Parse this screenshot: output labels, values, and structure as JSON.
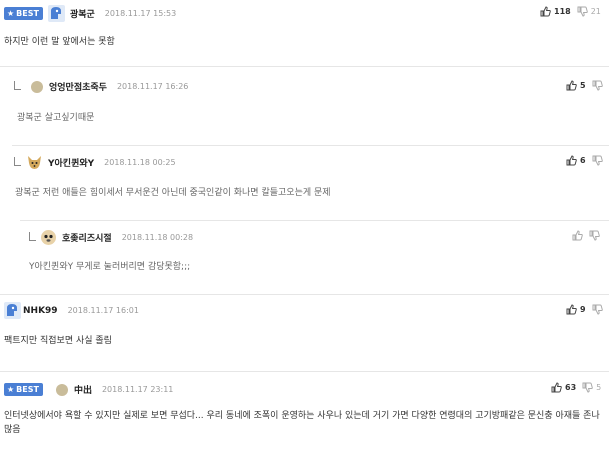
{
  "badge_label": "BEST",
  "comments": [
    {
      "nick": "광복군",
      "date": "2018.11.17 15:53",
      "text": "하지만 이런 말 앞에서는 못함",
      "up": "118",
      "down": "21"
    },
    {
      "nick": "엉엉만점초죽두",
      "date": "2018.11.17 16:26",
      "text": "광복군 살고싶기때문",
      "up": "5",
      "down": ""
    },
    {
      "nick": "Y아킨퀸와Y",
      "date": "2018.11.18 00:25",
      "text": "광복군 저런 애들은 힘이세서 무서운건 아닌데 중국인같이 화나면 칼들고오는게 문제",
      "up": "6",
      "down": ""
    },
    {
      "nick": "호좆리즈시절",
      "date": "2018.11.18 00:28",
      "text": "Y아킨퀸와Y 무게로 눌러버리면 감당못함;;;",
      "up": "",
      "down": ""
    },
    {
      "nick": "NHK99",
      "date": "2018.11.17 16:01",
      "text": "팩트지만 직접보면 사실 졸림",
      "up": "9",
      "down": ""
    },
    {
      "nick": "中出",
      "date": "2018.11.17 23:11",
      "text": "인터넷상에서야 욕할 수 있지만 실제로 보면 무섭다... 우리 동네에 조폭이 운영하는 사우나 있는데 거기 가면 다양한 연령대의 고기방패같은 문신충 아재들 존나 많음",
      "up": "63",
      "down": "5"
    }
  ],
  "colors": {
    "badge": "#4a7fd4",
    "avatar_blue": "#4a7fd4",
    "divider": "#e6e6e6"
  }
}
